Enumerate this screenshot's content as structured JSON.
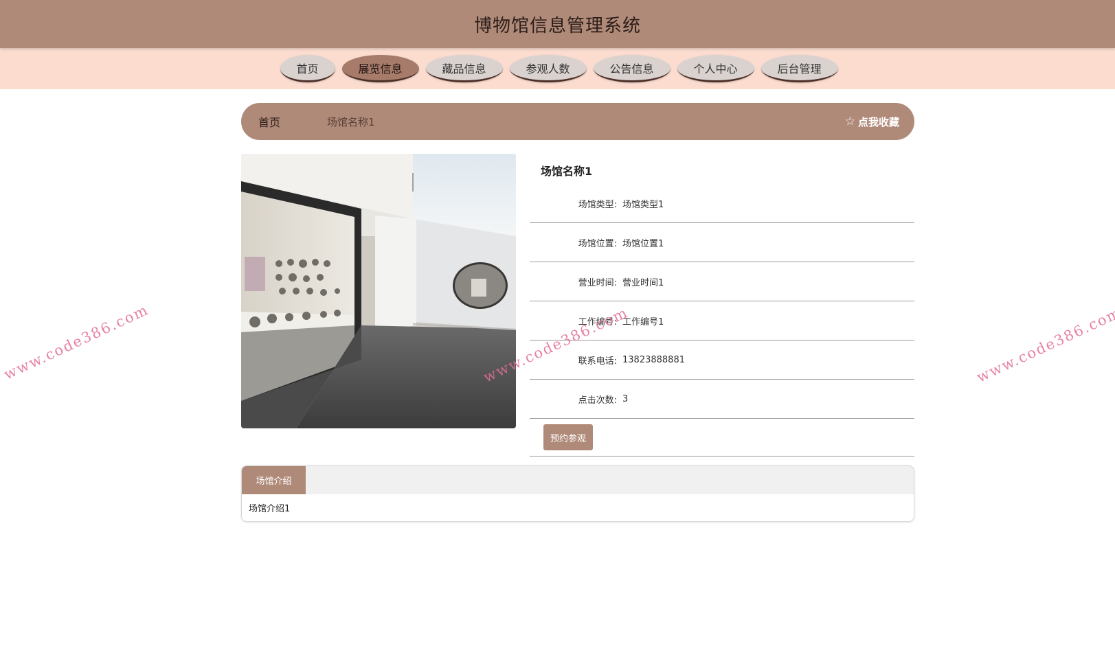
{
  "header": {
    "title": "博物馆信息管理系统"
  },
  "nav": {
    "items": [
      {
        "label": "首页",
        "active": false
      },
      {
        "label": "展览信息",
        "active": true
      },
      {
        "label": "藏品信息",
        "active": false
      },
      {
        "label": "参观人数",
        "active": false
      },
      {
        "label": "公告信息",
        "active": false
      },
      {
        "label": "个人中心",
        "active": false
      },
      {
        "label": "后台管理",
        "active": false
      }
    ]
  },
  "breadcrumb": {
    "home": "首页",
    "current": "场馆名称1",
    "favorite": "点我收藏"
  },
  "detail": {
    "title": "场馆名称1",
    "fields": [
      {
        "label": "场馆类型:",
        "value": "场馆类型1"
      },
      {
        "label": "场馆位置:",
        "value": "场馆位置1"
      },
      {
        "label": "营业时间:",
        "value": "营业时间1"
      },
      {
        "label": "工作编号:",
        "value": "工作编号1"
      },
      {
        "label": "联系电话:",
        "value": "13823888881"
      },
      {
        "label": "点击次数:",
        "value": "3"
      }
    ],
    "button": "预约参观"
  },
  "tabs": {
    "active": "场馆介绍",
    "content": "场馆介绍1"
  },
  "watermark": "www.code386.com",
  "colors": {
    "accent": "#b08a79",
    "nav_bg": "#fbdccf",
    "watermark": "#e36d96"
  }
}
